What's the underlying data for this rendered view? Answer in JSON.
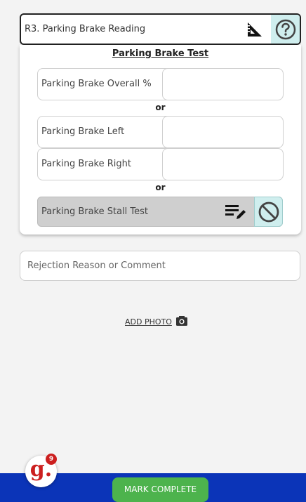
{
  "header": {
    "label": "R3. Parking Brake Reading",
    "icons": [
      "ruler-triangle-icon",
      "help-circle-icon"
    ]
  },
  "panel": {
    "title": "Parking Brake Test",
    "fields": [
      {
        "label": "Parking Brake Overall %",
        "value": ""
      },
      {
        "label": "Parking Brake Left",
        "value": ""
      },
      {
        "label": "Parking Brake Right",
        "value": ""
      }
    ],
    "separator": "or",
    "stall_test": {
      "label": "Parking Brake Stall Test",
      "icons": [
        "edit-notes-icon",
        "not-applicable-icon"
      ]
    }
  },
  "comment": {
    "placeholder": "Rejection Reason or Comment"
  },
  "add_photo": {
    "label": "ADD PHOTO",
    "icon": "camera-icon"
  },
  "footer": {
    "mark_complete": "MARK COMPLETE"
  },
  "logo": {
    "letter": "g.",
    "badge_count": "9"
  },
  "colors": {
    "accent_teal": "#cfeeee",
    "footer_blue": "#0b34b8",
    "complete_green": "#4db34d",
    "logo_red": "#cc1f1f"
  }
}
